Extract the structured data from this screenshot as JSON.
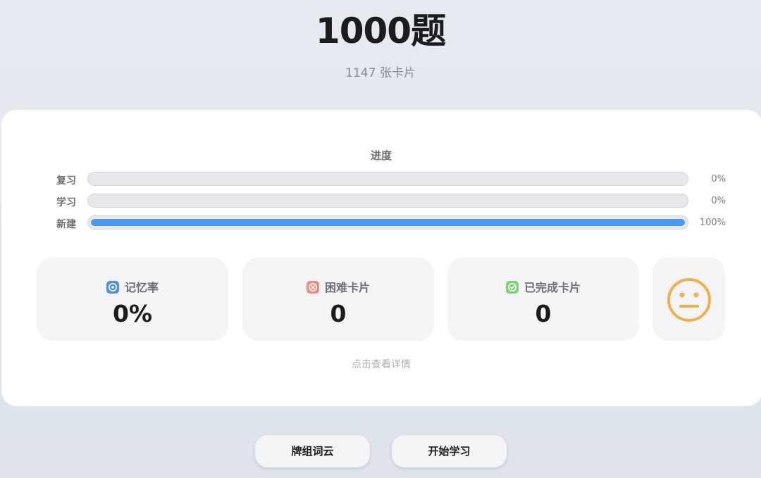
{
  "header": {
    "title": "1000题",
    "subtitle": "1147 张卡片"
  },
  "progress": {
    "title": "进度",
    "rows": [
      {
        "label": "复习",
        "value_text": "0%",
        "fraction": 0.0
      },
      {
        "label": "学习",
        "value_text": "0%",
        "fraction": 0.0
      },
      {
        "label": "新建",
        "value_text": "100%",
        "fraction": 1.0
      }
    ],
    "fill_color": "#4a9af4",
    "track_color": "#e8e8ec"
  },
  "stats": [
    {
      "label": "记忆率",
      "value": "0%",
      "icon": "target-icon",
      "icon_color": "#4a90e2"
    },
    {
      "label": "困难卡片",
      "value": "0",
      "icon": "x-circle-icon",
      "icon_color": "#ef8a84"
    },
    {
      "label": "已完成卡片",
      "value": "0",
      "icon": "check-circle-icon",
      "icon_color": "#7fcf7a"
    }
  ],
  "mood": {
    "icon": "neutral-face-icon",
    "color": "#eeb04a"
  },
  "details_link": "点击查看详情",
  "buttons": {
    "word_cloud": "牌组词云",
    "start": "开始学习"
  }
}
